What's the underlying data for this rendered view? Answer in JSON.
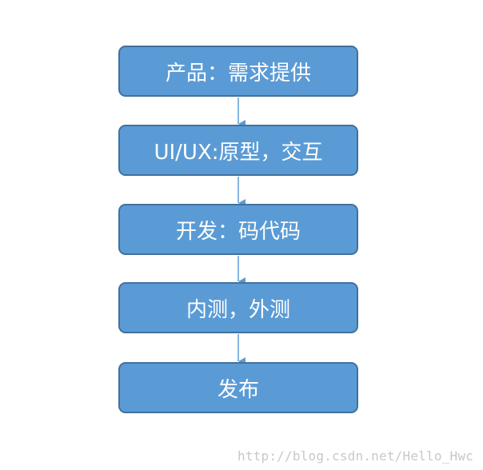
{
  "colors": {
    "box_fill": "#5b9bd5",
    "box_border": "#41719c",
    "box_text": "#ffffff",
    "arrow": "#5b9bd5",
    "watermark": "#c8c8c8"
  },
  "steps": [
    {
      "label": "产品：需求提供"
    },
    {
      "label": "UI/UX:原型，交互"
    },
    {
      "label": "开发：码代码"
    },
    {
      "label": "内测，外测"
    },
    {
      "label": "发布"
    }
  ],
  "watermark": "http://blog.csdn.net/Hello_Hwc"
}
